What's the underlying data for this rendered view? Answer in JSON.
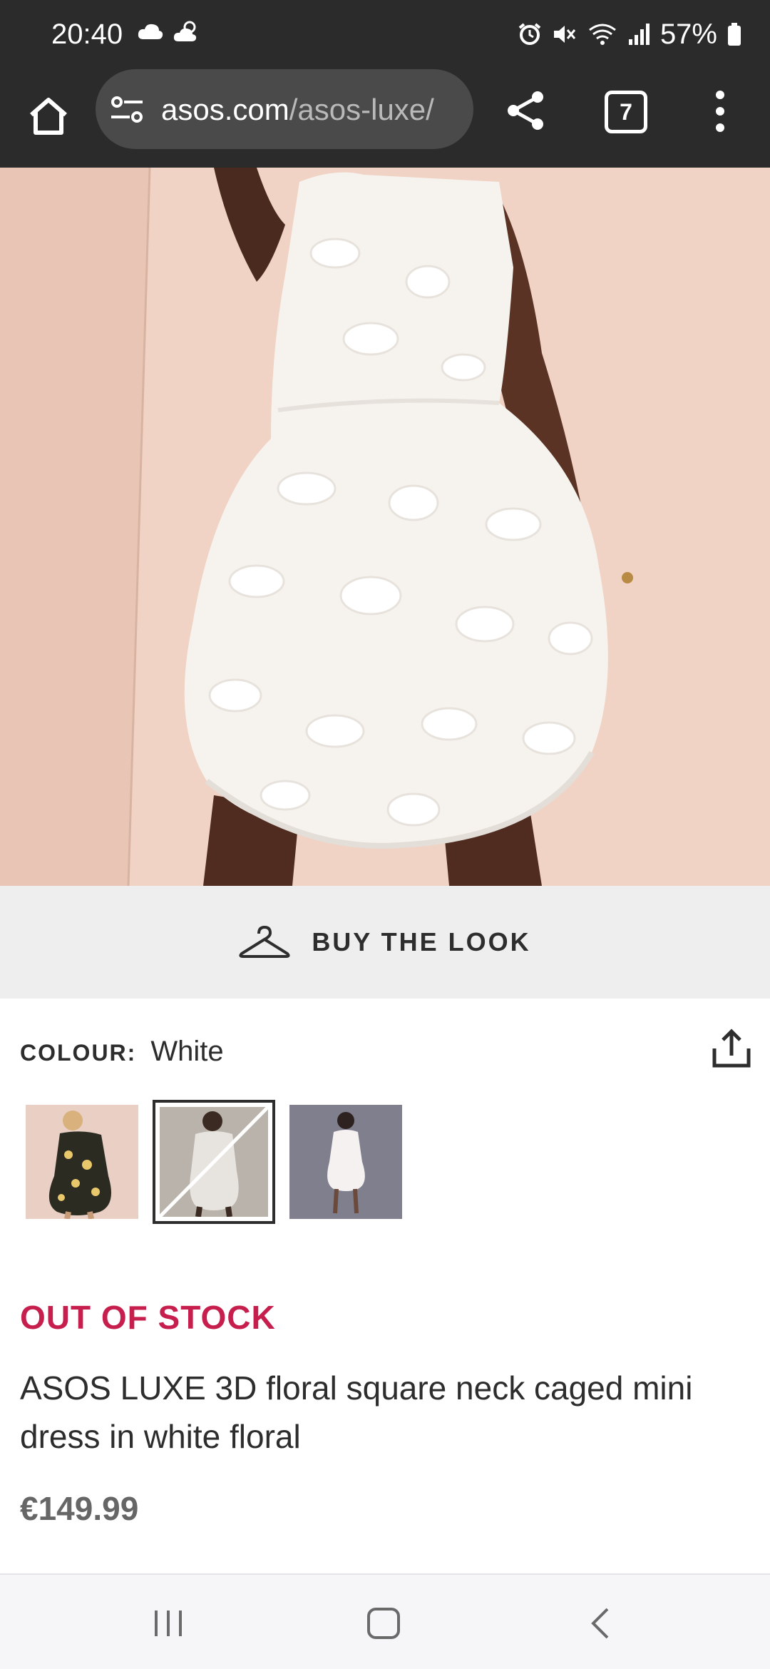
{
  "status_bar": {
    "time": "20:40",
    "battery": "57%",
    "icons": [
      "cloud-icon",
      "weather-icon",
      "alarm-icon",
      "mute-icon",
      "wifi-icon",
      "signal-icon",
      "battery-icon"
    ]
  },
  "browser": {
    "url_domain": "asos.com",
    "url_path": "/asos-luxe/",
    "tab_count": "7"
  },
  "product": {
    "carousel": {
      "count": 4,
      "active_index": 0
    },
    "buy_the_look": "BUY THE LOOK",
    "colour_label": "COLOUR:",
    "colour_value": "White",
    "swatches": [
      {
        "name": "black-floral",
        "selected": false,
        "available": true
      },
      {
        "name": "white",
        "selected": true,
        "available": false
      },
      {
        "name": "white-alt",
        "selected": false,
        "available": true
      }
    ],
    "stock_status": "OUT OF STOCK",
    "title": "ASOS LUXE 3D floral square neck caged mini dress in white floral",
    "price": "€149.99"
  },
  "colors": {
    "status_bar_bg": "#2b2b2b",
    "out_of_stock": "#c71f4d",
    "buy_look_bg": "#eeeeee"
  }
}
